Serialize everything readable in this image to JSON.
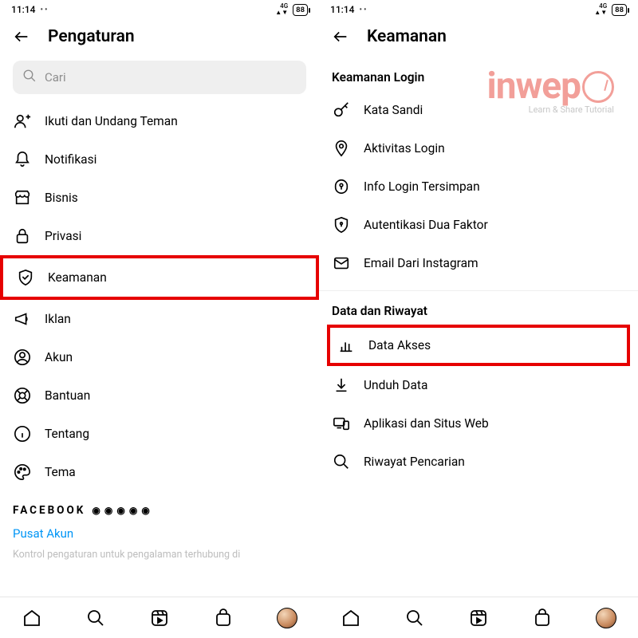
{
  "status": {
    "time": "11:14",
    "battery": "88",
    "netLabel1": "4G",
    "netLabel2": "4G"
  },
  "left": {
    "title": "Pengaturan",
    "searchPlaceholder": "Cari",
    "items": [
      {
        "label": "Ikuti dan Undang Teman"
      },
      {
        "label": "Notifikasi"
      },
      {
        "label": "Bisnis"
      },
      {
        "label": "Privasi"
      },
      {
        "label": "Keamanan"
      },
      {
        "label": "Iklan"
      },
      {
        "label": "Akun"
      },
      {
        "label": "Bantuan"
      },
      {
        "label": "Tentang"
      },
      {
        "label": "Tema"
      }
    ],
    "facebook": "FACEBOOK",
    "pusatAkun": "Pusat Akun",
    "footnote": "Kontrol pengaturan untuk pengalaman terhubung di"
  },
  "right": {
    "title": "Keamanan",
    "section1": "Keamanan Login",
    "items1": [
      {
        "label": "Kata Sandi"
      },
      {
        "label": "Aktivitas Login"
      },
      {
        "label": "Info Login Tersimpan"
      },
      {
        "label": "Autentikasi Dua Faktor"
      },
      {
        "label": "Email Dari Instagram"
      }
    ],
    "section2": "Data dan Riwayat",
    "items2": [
      {
        "label": "Data Akses"
      },
      {
        "label": "Unduh Data"
      },
      {
        "label": "Aplikasi dan Situs Web"
      },
      {
        "label": "Riwayat Pencarian"
      }
    ]
  },
  "watermark": {
    "text": "inwep",
    "tagline": "Learn & Share Tutorial"
  }
}
